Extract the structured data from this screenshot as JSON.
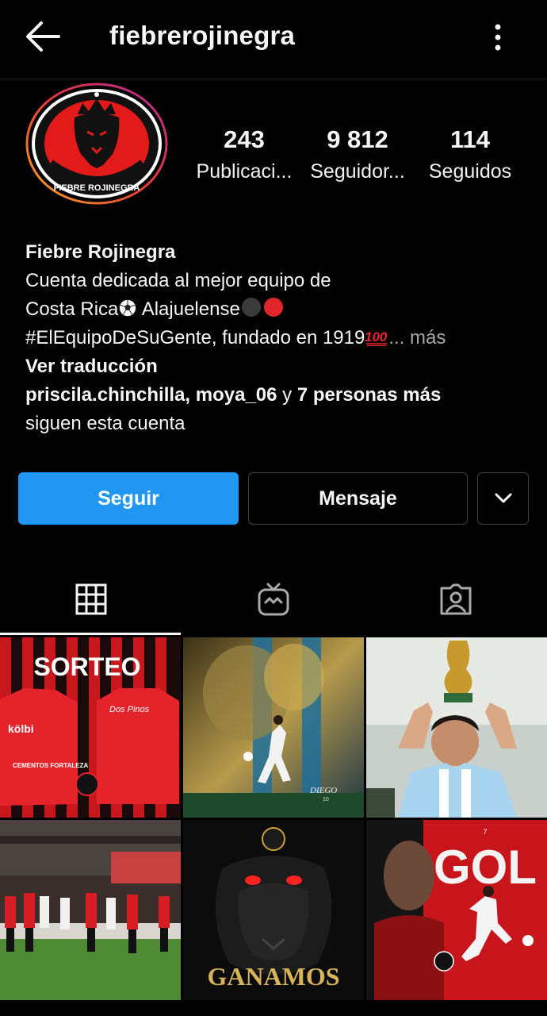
{
  "header": {
    "username": "fiebrerojinegra",
    "back_icon": "back-arrow-icon",
    "more_icon": "more-vertical-icon"
  },
  "profile": {
    "avatar_text": "FIEBRE ROJINEGRA",
    "stats": [
      {
        "value": "243",
        "label": "Publicaci..."
      },
      {
        "value": "9 812",
        "label": "Seguidor..."
      },
      {
        "value": "114",
        "label": "Seguidos"
      }
    ]
  },
  "bio": {
    "name": "Fiebre Rojinegra",
    "line1": "Cuenta dedicada al mejor equipo de",
    "line2a": "Costa Rica",
    "line2b": " Alajuelense",
    "line3a": "#ElEquipoDeSuGente, fundado en 1919",
    "line3b": "... más",
    "translate": "Ver traducción",
    "followers_a": "priscila.chinchilla",
    "followers_sep": ", ",
    "followers_b": "moya_06",
    "followers_c": " y ",
    "followers_d": "7 personas más",
    "followers_e": "siguen esta cuenta"
  },
  "actions": {
    "follow": "Seguir",
    "message": "Mensaje"
  },
  "tabs": [
    "grid-icon",
    "igtv-icon",
    "tagged-icon"
  ],
  "posts": [
    {
      "title": "SORTEO",
      "kolbi": "kölbi",
      "sponsor": "CEMENTOS FORTALEZA",
      "brand": "Dos Pinos"
    },
    {
      "signature": "DIEGO",
      "number": "10"
    },
    {
      "caption": ""
    },
    {
      "caption": ""
    },
    {
      "title": "GANAMOS"
    },
    {
      "title": "GOL",
      "number": "7"
    }
  ],
  "colors": {
    "accent": "#2196f3",
    "background": "#000000",
    "team_red": "#d9141b"
  }
}
